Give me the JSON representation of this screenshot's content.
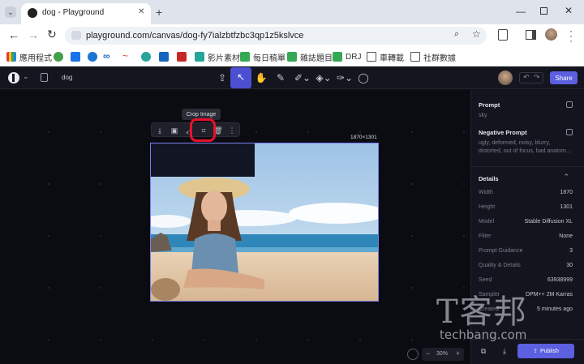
{
  "browser": {
    "tab_title": "dog - Playground",
    "url": "playground.com/canvas/dog-fy7ialzbtfzbc3qp1z5kslvce",
    "bookmarks": [
      "應用程式",
      "影片素材",
      "每日稿單",
      "雜誌題目",
      "DRJ",
      "車轉載",
      "社群數據"
    ]
  },
  "app": {
    "file_name": "dog",
    "share_label": "Share",
    "tooltip": "Crop Image",
    "image_size": "1870×1301",
    "zoom": "30%",
    "publish_label": "Publish",
    "accent": "#5b5fe0",
    "crop_highlight": "#e8102a"
  },
  "panel": {
    "prompt_label": "Prompt",
    "prompt_value": "sky",
    "negative_label": "Negative Prompt",
    "negative_value_1": "ugly, deformed, noisy, blurry,",
    "negative_value_2": "distorted, out of focus, bad anatom...",
    "details_label": "Details",
    "details": [
      {
        "label": "Width",
        "value": "1870"
      },
      {
        "label": "Height",
        "value": "1301"
      },
      {
        "label": "Model",
        "value": "Stable Diffusion XL"
      },
      {
        "label": "Filter",
        "value": "None"
      },
      {
        "label": "Prompt Guidance",
        "value": "3"
      },
      {
        "label": "Quality & Details",
        "value": "30"
      },
      {
        "label": "Seed",
        "value": "63938999"
      },
      {
        "label": "Sampler",
        "value": "DPM++ 2M Karras"
      },
      {
        "label": "Created",
        "value": "5 minutes ago"
      }
    ]
  },
  "watermark": {
    "cjk": "T客邦",
    "latin": "techbang.com"
  }
}
